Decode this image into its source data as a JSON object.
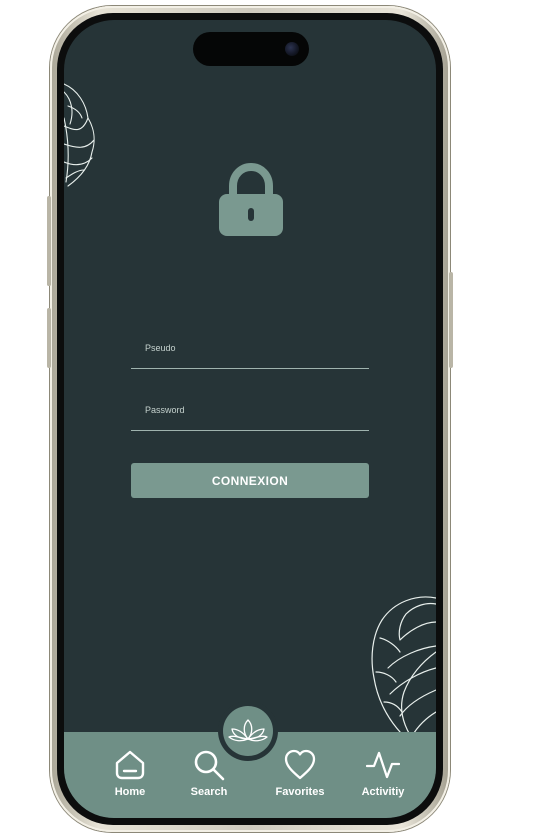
{
  "login": {
    "pseudo_placeholder": "Pseudo",
    "password_placeholder": "Password",
    "submit_label": "CONNEXION"
  },
  "tabbar": {
    "center_icon": "lotus-icon",
    "items": [
      {
        "label": "Home",
        "icon": "home-icon"
      },
      {
        "label": "Search",
        "icon": "search-icon"
      },
      {
        "label": "Favorites",
        "icon": "heart-icon"
      },
      {
        "label": "Activitiy",
        "icon": "activity-icon"
      }
    ]
  },
  "colors": {
    "screen_background": "#263437",
    "accent": "#7a9990",
    "tabbar": "#6f8f86",
    "text": "#ffffff"
  }
}
